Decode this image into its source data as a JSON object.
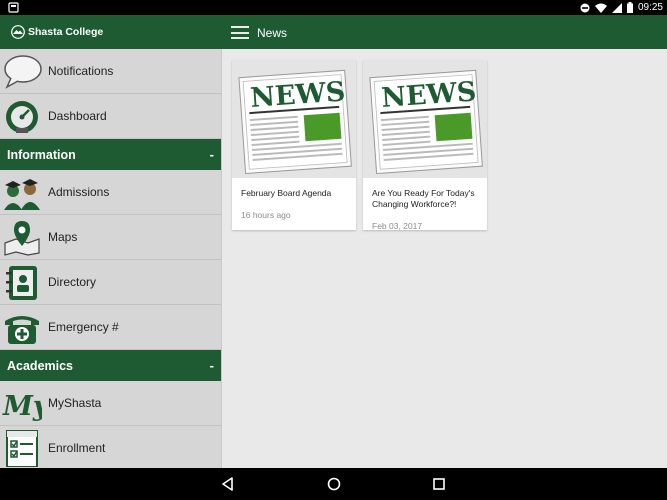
{
  "status_bar": {
    "time": "09:25",
    "icons": [
      "do-not-disturb-icon",
      "wifi-icon",
      "signal-icon",
      "battery-icon"
    ]
  },
  "app": {
    "logo_text": "Shasta College",
    "title": "News"
  },
  "sidebar": {
    "items_top": [
      {
        "label": "Notifications",
        "icon": "speech-bubble-icon"
      },
      {
        "label": "Dashboard",
        "icon": "gauge-icon"
      }
    ],
    "sections": [
      {
        "title": "Information",
        "toggle": "-",
        "items": [
          {
            "label": "Admissions",
            "icon": "graduates-icon"
          },
          {
            "label": "Maps",
            "icon": "map-pin-icon"
          },
          {
            "label": "Directory",
            "icon": "address-book-icon"
          },
          {
            "label": "Emergency #",
            "icon": "emergency-phone-icon"
          }
        ]
      },
      {
        "title": "Academics",
        "toggle": "-",
        "items": [
          {
            "label": "MyShasta",
            "icon": "my-script-icon"
          },
          {
            "label": "Enrollment",
            "icon": "class-checklist-icon"
          }
        ]
      }
    ]
  },
  "news": {
    "cards": [
      {
        "title": "February Board Agenda",
        "date": "16 hours ago",
        "thumb_text": "NEWS"
      },
      {
        "title": "Are You Ready For Today's Changing Workforce?!",
        "date": "Feb 03, 2017",
        "thumb_text": "NEWS"
      }
    ]
  },
  "colors": {
    "brand_green": "#1e5a32",
    "sidebar_bg": "#d6d6d6",
    "content_bg": "#e9e9e9"
  }
}
